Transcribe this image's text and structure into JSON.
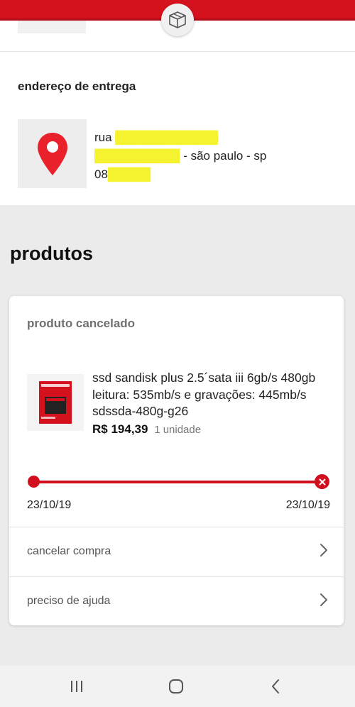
{
  "header": {
    "icon": "package-box-icon",
    "color": "#d6111e"
  },
  "address": {
    "title": "endereço de entrega",
    "icon": "map-pin-icon",
    "line1_visible": "rua",
    "line1_redacted": "████████████",
    "line2_redacted": "██████████",
    "line2_visible": "- são paulo - sp",
    "line3_visible": "08",
    "line3_redacted": "█████"
  },
  "products": {
    "title": "produtos",
    "card": {
      "status": "produto cancelado",
      "image_icon": "ssd-product-image",
      "description": "ssd sandisk plus 2.5´sata iii 6gb/s 480gb leitura: 535mb/s e gravações: 445mb/s sdssda-480g-g26",
      "price": "R$ 194,39",
      "quantity": "1 unidade",
      "timeline": {
        "start_date": "23/10/19",
        "end_date": "23/10/19",
        "end_icon": "cancel-x-icon"
      },
      "actions": [
        {
          "label": "cancelar compra",
          "icon": "chevron-right-icon"
        },
        {
          "label": "preciso de ajuda",
          "icon": "chevron-right-icon"
        }
      ]
    }
  },
  "navbar": {
    "items": [
      "recent-apps-icon",
      "home-icon",
      "back-icon"
    ]
  }
}
